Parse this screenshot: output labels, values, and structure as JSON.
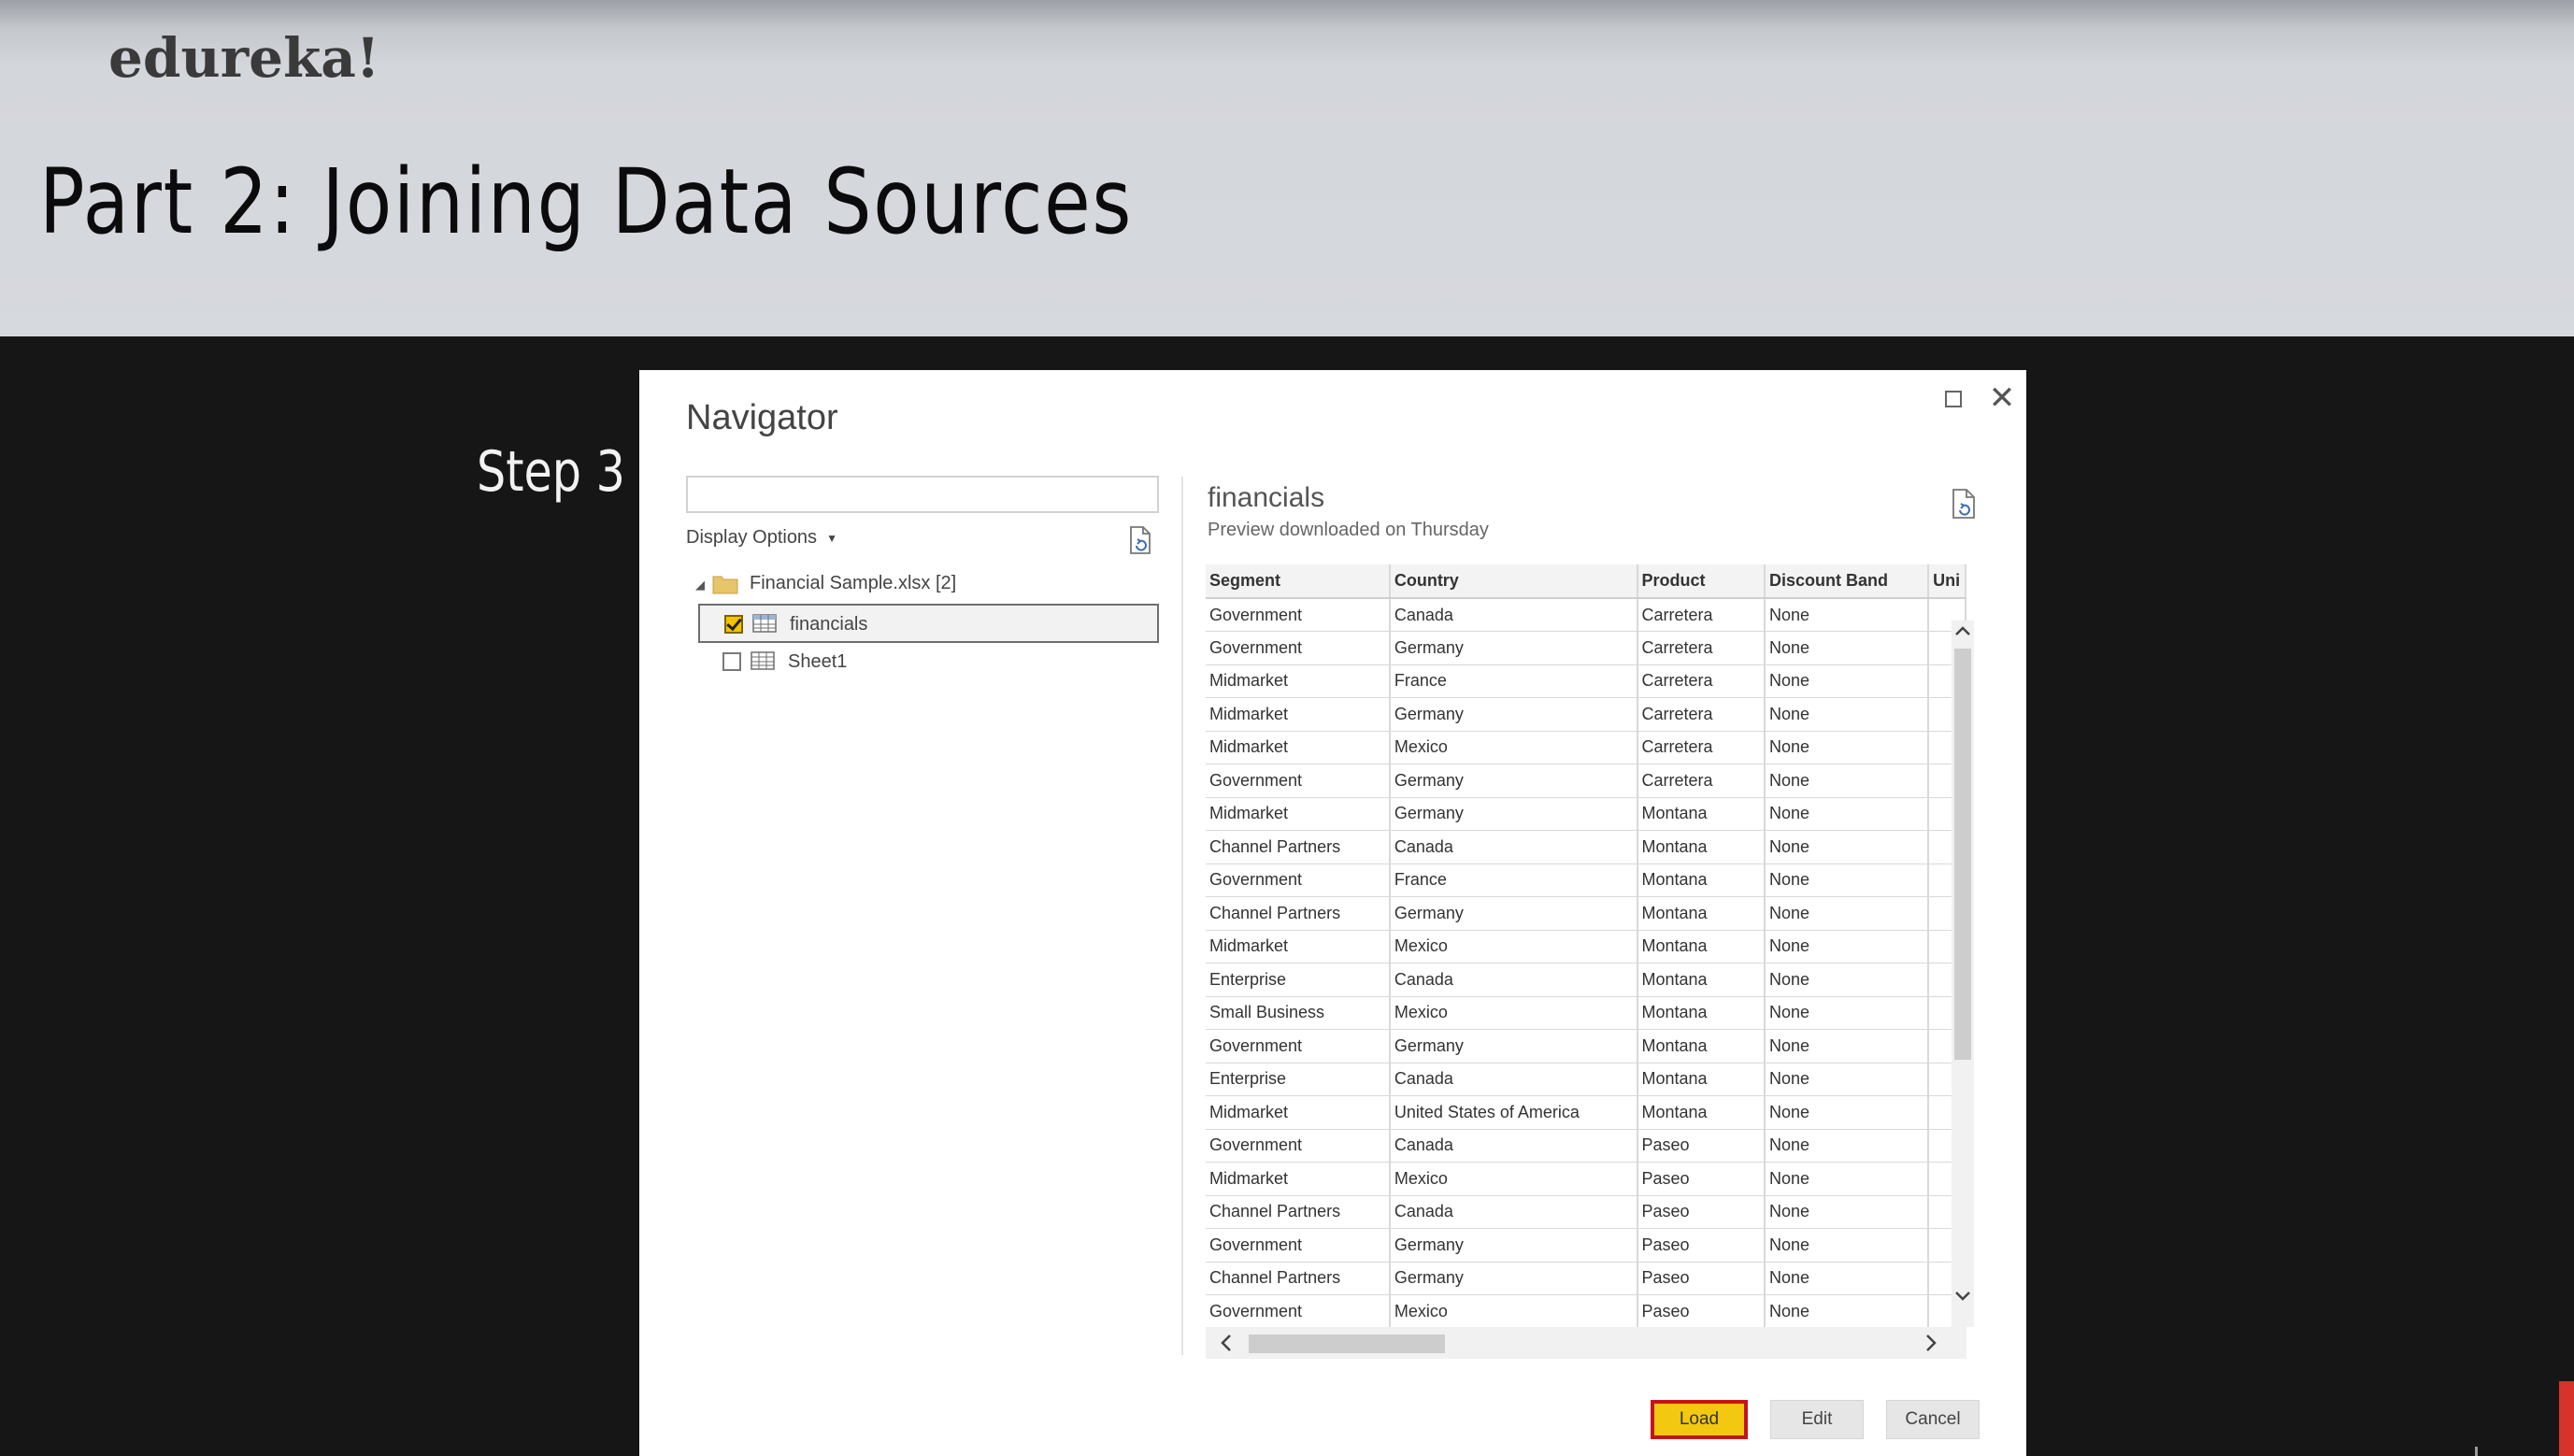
{
  "slide": {
    "brand": "edureka!",
    "title": "Part 2: Joining Data Sources",
    "step_label": "Step 3"
  },
  "dialog": {
    "title": "Navigator",
    "search": {
      "value": "",
      "placeholder": ""
    },
    "display_options_label": "Display Options",
    "tree": {
      "root_label": "Financial Sample.xlsx [2]",
      "items": [
        {
          "label": "financials",
          "checked": true,
          "selected": true
        },
        {
          "label": "Sheet1",
          "checked": false,
          "selected": false
        }
      ]
    },
    "preview": {
      "name": "financials",
      "subtitle": "Preview downloaded on Thursday",
      "columns": [
        "Segment",
        "Country",
        "Product",
        "Discount Band",
        "Uni"
      ],
      "rows": [
        [
          "Government",
          "Canada",
          "Carretera",
          "None"
        ],
        [
          "Government",
          "Germany",
          "Carretera",
          "None"
        ],
        [
          "Midmarket",
          "France",
          "Carretera",
          "None"
        ],
        [
          "Midmarket",
          "Germany",
          "Carretera",
          "None"
        ],
        [
          "Midmarket",
          "Mexico",
          "Carretera",
          "None"
        ],
        [
          "Government",
          "Germany",
          "Carretera",
          "None"
        ],
        [
          "Midmarket",
          "Germany",
          "Montana",
          "None"
        ],
        [
          "Channel Partners",
          "Canada",
          "Montana",
          "None"
        ],
        [
          "Government",
          "France",
          "Montana",
          "None"
        ],
        [
          "Channel Partners",
          "Germany",
          "Montana",
          "None"
        ],
        [
          "Midmarket",
          "Mexico",
          "Montana",
          "None"
        ],
        [
          "Enterprise",
          "Canada",
          "Montana",
          "None"
        ],
        [
          "Small Business",
          "Mexico",
          "Montana",
          "None"
        ],
        [
          "Government",
          "Germany",
          "Montana",
          "None"
        ],
        [
          "Enterprise",
          "Canada",
          "Montana",
          "None"
        ],
        [
          "Midmarket",
          "United States of America",
          "Montana",
          "None"
        ],
        [
          "Government",
          "Canada",
          "Paseo",
          "None"
        ],
        [
          "Midmarket",
          "Mexico",
          "Paseo",
          "None"
        ],
        [
          "Channel Partners",
          "Canada",
          "Paseo",
          "None"
        ],
        [
          "Government",
          "Germany",
          "Paseo",
          "None"
        ],
        [
          "Channel Partners",
          "Germany",
          "Paseo",
          "None"
        ],
        [
          "Government",
          "Mexico",
          "Paseo",
          "None"
        ]
      ]
    },
    "buttons": {
      "load": "Load",
      "edit": "Edit",
      "cancel": "Cancel"
    },
    "colors": {
      "load_bg": "#f2c811",
      "load_border": "#c4151c",
      "checkbox": "#f3c300",
      "folder": "#e8c46a"
    }
  }
}
